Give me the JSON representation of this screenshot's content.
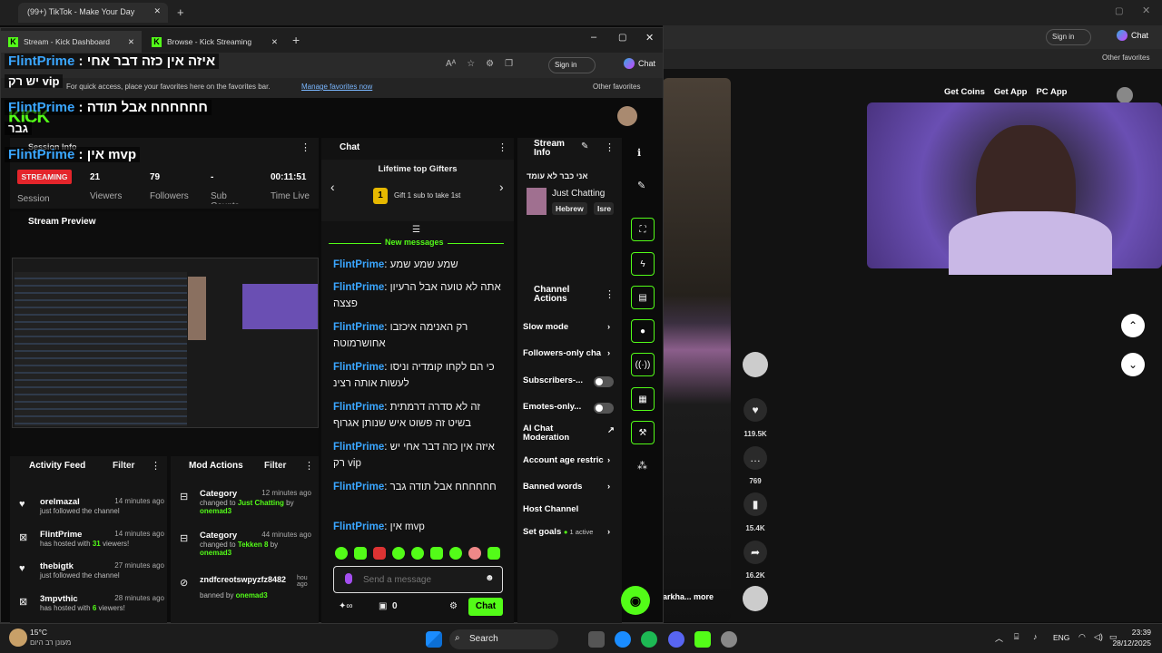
{
  "bg_browser": {
    "tab_title": "(99+) TikTok - Make Your Day",
    "signin": "Sign in",
    "chat_label": "Chat",
    "other_favorites": "Other favorites"
  },
  "tiktok": {
    "get_coins": "Get Coins",
    "get_app": "Get App",
    "pc_app": "PC App",
    "likes": "119.5K",
    "comments": "769",
    "saves": "15.4K",
    "shares": "16.2K",
    "caption": "arkha... more"
  },
  "browser": {
    "tabs": [
      {
        "label": "Stream - Kick Dashboard"
      },
      {
        "label": "Browse - Kick Streaming"
      }
    ],
    "signin": "Sign in",
    "chat_label": "Chat",
    "favbar_text": "For quick access, place your favorites here on the favorites bar.",
    "manage_fav": "Manage favorites now",
    "other_favorites": "Other favorites"
  },
  "overlay": [
    {
      "user": "FlintPrime",
      "text": ": איזה אין כזה דבר אחי"
    },
    {
      "user": "",
      "text": "יש רק vip"
    },
    {
      "user": "FlintPrime",
      "text": ": חחחחחח אבל תודה"
    },
    {
      "user": "",
      "text": "גבר"
    },
    {
      "user": "FlintPrime",
      "text": ": אין mvp"
    }
  ],
  "session": {
    "title": "Session Info",
    "status": "STREAMING",
    "session_label": "Session",
    "viewers": "21",
    "viewers_label": "Viewers",
    "followers": "79",
    "followers_label": "Followers",
    "subs": "-",
    "subs_label": "Sub Counts",
    "time_live": "00:11:51",
    "time_label": "Time Live"
  },
  "preview": {
    "title": "Stream Preview"
  },
  "activity": {
    "title": "Activity Feed",
    "filter": "Filter",
    "items": [
      {
        "name": "orelmazal",
        "time": "14 minutes ago",
        "sub": "just followed the channel",
        "icon": "heart-icon"
      },
      {
        "name": "FlintPrime",
        "time": "14 minutes ago",
        "sub_pre": "has hosted with ",
        "count": "31",
        "sub_post": " viewers!",
        "icon": "host-icon"
      },
      {
        "name": "thebigtk",
        "time": "27 minutes ago",
        "sub": "just followed the channel",
        "icon": "heart-icon"
      },
      {
        "name": "3mpvthic",
        "time": "28 minutes ago",
        "sub_pre": "has hosted with ",
        "count": "6",
        "sub_post": " viewers!",
        "icon": "host-icon"
      }
    ]
  },
  "mod": {
    "title": "Mod Actions",
    "filter": "Filter",
    "items": [
      {
        "name": "Category",
        "time": "12 minutes ago",
        "pre": "changed to ",
        "val": "Just Chatting",
        "mid": " by ",
        "by": "onemad3"
      },
      {
        "name": "Category",
        "time": "44 minutes ago",
        "pre": "changed to ",
        "val": "Tekken 8",
        "mid": " by ",
        "by": "onemad3"
      },
      {
        "name": "zndfcreotswpyzfz8482",
        "time": "hou ago",
        "pre": "banned by ",
        "val": "",
        "mid": "",
        "by": "onemad3"
      }
    ]
  },
  "chat": {
    "title": "Chat",
    "gifters_title": "Lifetime top Gifters",
    "gift_text": "Gift 1 sub to take 1st",
    "gift_rank": "1",
    "new_messages": "New messages",
    "messages": [
      {
        "user": "FlintPrime",
        "text": "שמע שמע שמע"
      },
      {
        "user": "FlintPrime",
        "text": "אתה לא טועה אבל הרעיון פצצה"
      },
      {
        "user": "FlintPrime",
        "text": "רק האנימה איכזבו אחושרמוטה"
      },
      {
        "user": "FlintPrime",
        "text": "כי הם לקחו קומדיה וניסו לעשות אותה רצינ"
      },
      {
        "user": "FlintPrime",
        "text": "זה לא סדרה דרמתית בשיט זה פשוט איש שנותן אגרוף"
      },
      {
        "user": "FlintPrime",
        "text": "איזה אין כזה דבר אחי יש רק vip"
      },
      {
        "user": "FlintPrime",
        "text": "חחחחחח אבל תודה גבר"
      },
      {
        "user": "FlintPrime",
        "text": "אין mvp"
      }
    ],
    "placeholder": "Send a message",
    "points": "0",
    "send": "Chat"
  },
  "stream_info": {
    "title": "Stream Info",
    "stream_title": "אני כבר לא עומד",
    "category": "Just Chatting",
    "tags": [
      "Hebrew",
      "Isre"
    ]
  },
  "channel_actions": {
    "title": "Channel Actions",
    "items": [
      {
        "label": "Slow mode",
        "kind": "arrow"
      },
      {
        "label": "Followers-only cha",
        "kind": "arrow"
      },
      {
        "label": "Subscribers-...",
        "kind": "toggle"
      },
      {
        "label": "Emotes-only...",
        "kind": "toggle"
      },
      {
        "label": "AI Chat Moderation",
        "kind": "ext"
      },
      {
        "label": "Account age restric",
        "kind": "arrow"
      },
      {
        "label": "Banned words",
        "kind": "arrow"
      },
      {
        "label": "Host Channel",
        "kind": "none"
      },
      {
        "label": "Set goals",
        "kind": "goal",
        "badge": "1 active"
      }
    ]
  },
  "taskbar": {
    "weather_temp": "15°C",
    "weather_desc": "מעונן רב היום",
    "search": "Search",
    "lang": "ENG",
    "time": "23:39",
    "date": "28/12/2025"
  },
  "colors": {
    "kick_green": "#53fc18",
    "username_blue": "#3aa6ff",
    "streaming_red": "#e4252b"
  }
}
